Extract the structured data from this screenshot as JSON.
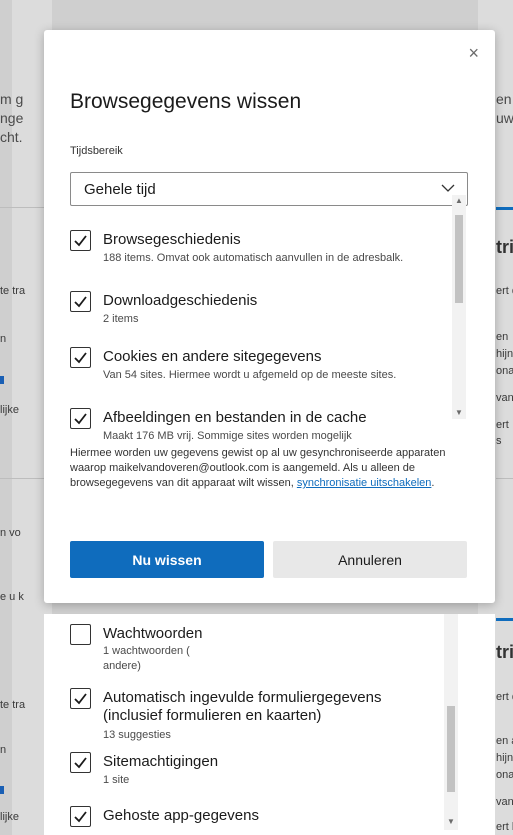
{
  "background": {
    "left_fragments": [
      "m g",
      "nge",
      "cht.",
      "te tra",
      "n",
      "lijke",
      "n vo",
      "e u k"
    ],
    "right_fragments": [
      "en",
      "uw",
      "tri",
      "ert d",
      "en",
      "hijn",
      "ona",
      "van",
      "ert",
      "s"
    ],
    "lower_left_fragments": [
      "te tra",
      "n",
      "lijke"
    ],
    "lower_right_fragments": [
      "tri",
      "ert d",
      "en a",
      "hijnli",
      "onal",
      "van s",
      "ert b"
    ]
  },
  "dialog": {
    "title": "Browsegegevens wissen",
    "close_glyph": "×",
    "range_label": "Tijdsbereik",
    "range_value": "Gehele tijd",
    "items": [
      {
        "title": "Browsegeschiedenis",
        "desc": "188 items. Omvat ook automatisch aanvullen in de adresbalk.",
        "checked": true
      },
      {
        "title": "Downloadgeschiedenis",
        "desc": "2 items",
        "checked": true
      },
      {
        "title": "Cookies en andere sitegegevens",
        "desc": "Van 54 sites. Hiermee wordt u afgemeld op de meeste sites.",
        "checked": true
      },
      {
        "title": "Afbeeldingen en bestanden in de cache",
        "desc": "Maakt 176 MB vrij. Sommige sites worden mogelijk",
        "checked": true
      }
    ],
    "info_text": "Hiermee worden uw gegevens gewist op al uw gesynchroniseerde apparaten waarop maikelvandoveren@outlook.com is aangemeld. Als u alleen de browsegegevens van dit apparaat wilt wissen,",
    "info_link": "synchronisatie uitschakelen",
    "info_end": ".",
    "clear_button": "Nu wissen",
    "cancel_button": "Annuleren"
  },
  "dialog_scrolled": {
    "items": [
      {
        "title": "Wachtwoorden",
        "desc": "1 wachtwoorden (",
        "desc2": "andere)",
        "checked": false
      },
      {
        "title": "Automatisch ingevulde formuliergegevens (inclusief formulieren en kaarten)",
        "desc": "13 suggesties",
        "checked": true
      },
      {
        "title": "Sitemachtigingen",
        "desc": "1 site",
        "checked": true
      },
      {
        "title": "Gehoste app-gegevens",
        "desc": "",
        "checked": true
      }
    ]
  },
  "colors": {
    "accent": "#0f6cbd",
    "overlay": "#cfcfcf"
  }
}
